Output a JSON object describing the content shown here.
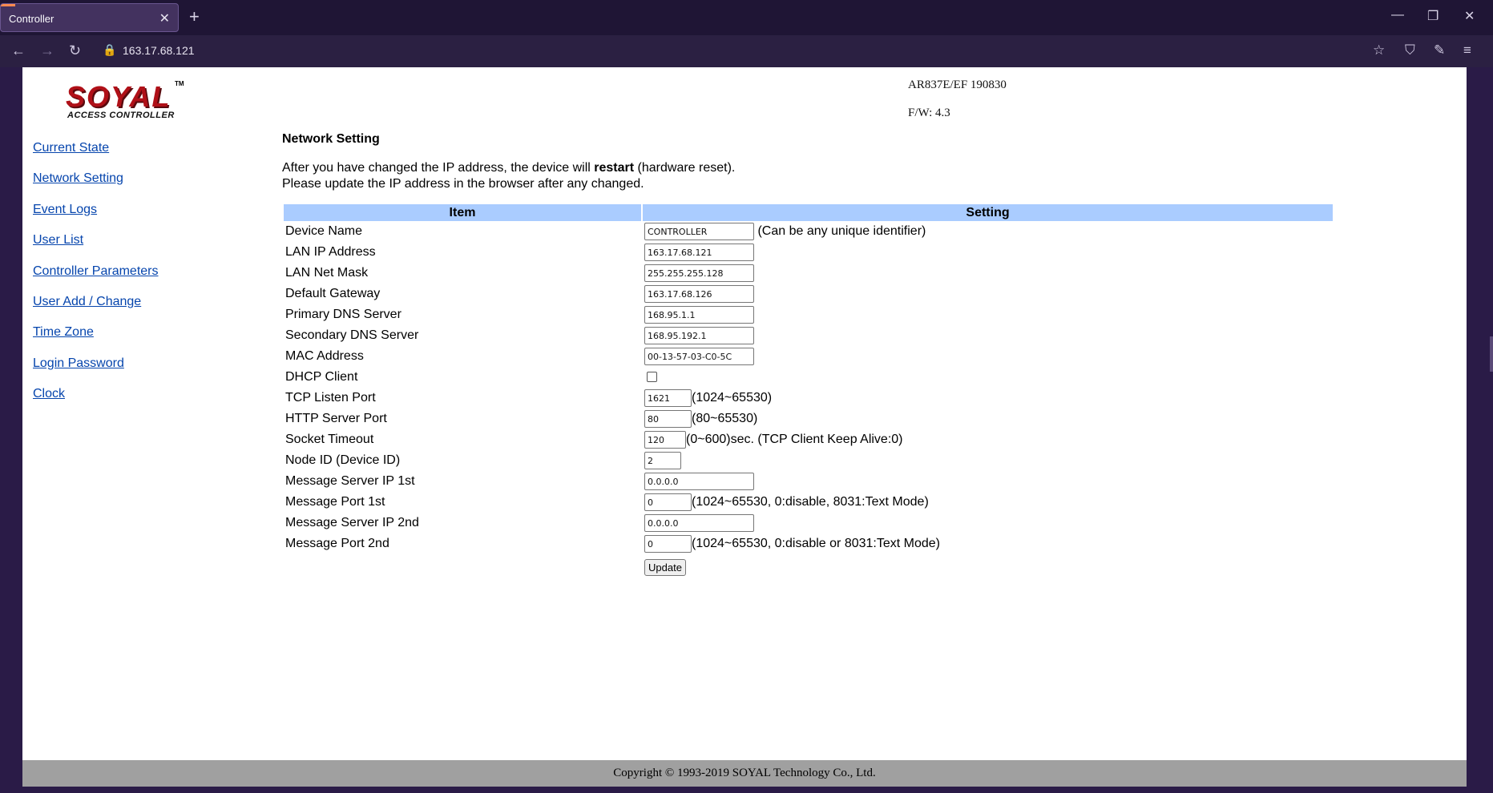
{
  "browser": {
    "tab_title": "Controller",
    "tab_close": "✕",
    "new_tab": "+",
    "url": "163.17.68.121",
    "window_controls": {
      "minimize": "—",
      "restore": "❐",
      "close": "✕"
    },
    "nav_icons": {
      "back": "←",
      "forward": "→",
      "reload": "↻",
      "lock": "🔒",
      "bookmark": "☆",
      "shield": "⛉",
      "extensions": "✎",
      "menu": "≡"
    }
  },
  "header": {
    "logo_main": "SOYAL",
    "logo_tm": "TM",
    "logo_sub": "ACCESS CONTROLLER",
    "model": "AR837E/EF 190830",
    "firmware": "F/W: 4.3"
  },
  "sidebar": {
    "items": [
      {
        "label": "Current State"
      },
      {
        "label": "Network Setting"
      },
      {
        "label": "Event Logs"
      },
      {
        "label": "User List"
      },
      {
        "label": "Controller Parameters"
      },
      {
        "label": "User Add / Change"
      },
      {
        "label": "Time Zone"
      },
      {
        "label": "Login Password"
      },
      {
        "label": "Clock"
      }
    ]
  },
  "main": {
    "title": "Network Setting",
    "note_prefix": "After you have changed the IP address, the device will ",
    "note_bold": "restart",
    "note_suffix": " (hardware reset).",
    "note_line2": "Please update the IP address in the browser after any changed.",
    "table": {
      "headers": {
        "item": "Item",
        "setting": "Setting"
      },
      "rows": [
        {
          "label": "Device Name",
          "value": "CONTROLLER",
          "hint": "(Can be any unique identifier)"
        },
        {
          "label": "LAN IP Address",
          "value": "163.17.68.121"
        },
        {
          "label": "LAN Net Mask",
          "value": "255.255.255.128"
        },
        {
          "label": "Default Gateway",
          "value": "163.17.68.126"
        },
        {
          "label": "Primary DNS Server",
          "value": "168.95.1.1"
        },
        {
          "label": "Secondary DNS Server",
          "value": "168.95.192.1"
        },
        {
          "label": "MAC Address",
          "value": "00-13-57-03-C0-5C"
        },
        {
          "label": "DHCP Client",
          "checked": false
        },
        {
          "label": "TCP Listen Port",
          "value": "1621",
          "hint": "(1024~65530)"
        },
        {
          "label": "HTTP Server Port",
          "value": "80",
          "hint": "(80~65530)"
        },
        {
          "label": "Socket Timeout",
          "value": "120",
          "hint": "(0~600)sec. (TCP Client Keep Alive:0)"
        },
        {
          "label": "Node ID (Device ID)",
          "value": "2"
        },
        {
          "label": "Message Server IP 1st",
          "value": "0.0.0.0"
        },
        {
          "label": "Message Port 1st",
          "value": "0",
          "hint": "(1024~65530, 0:disable,  8031:Text Mode)"
        },
        {
          "label": "Message Server IP 2nd",
          "value": "0.0.0.0"
        },
        {
          "label": "Message Port 2nd",
          "value": "0",
          "hint": "(1024~65530, 0:disable or 8031:Text Mode)"
        }
      ]
    },
    "update_button": "Update"
  },
  "footer": {
    "copyright": "Copyright © 1993-2019 SOYAL Technology Co., Ltd."
  },
  "colors": {
    "header_row": "#aaccff",
    "link": "#0645ad",
    "footer_bg": "#a0a0a0",
    "logo_red": "#b01018"
  }
}
